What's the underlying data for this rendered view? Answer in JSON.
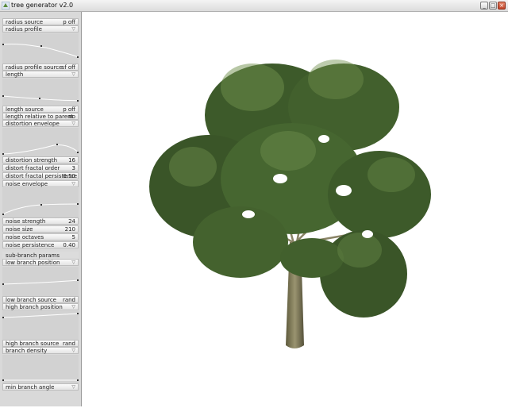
{
  "window": {
    "title": "tree generator v2.0",
    "minimize": "_",
    "maximize": "□",
    "close": "×"
  },
  "panel": {
    "radius_source": {
      "label": "radius source",
      "value": "p off"
    },
    "radius_profile": {
      "label": "radius profile"
    },
    "radius_profile_source": {
      "label": "radius profile source",
      "value": "sf off"
    },
    "length": {
      "label": "length"
    },
    "length_source": {
      "label": "length source",
      "value": "p off"
    },
    "length_relative": {
      "label": "length relative to parent",
      "value": "no"
    },
    "distortion_envelope": {
      "label": "distortion envelope"
    },
    "distortion_strength": {
      "label": "distortion strength",
      "value": "16"
    },
    "distort_fractal_order": {
      "label": "distort fractal order",
      "value": "3"
    },
    "distort_fractal_persistence": {
      "label": "distort fractal persistence",
      "value": "0.50"
    },
    "noise_envelope": {
      "label": "noise envelope"
    },
    "noise_strength": {
      "label": "noise strength",
      "value": "24"
    },
    "noise_size": {
      "label": "noise size",
      "value": "210"
    },
    "noise_octaves": {
      "label": "noise octaves",
      "value": "5"
    },
    "noise_persistence": {
      "label": "noise persistence",
      "value": "0.40"
    },
    "sub_branch_params": {
      "label": "sub-branch params"
    },
    "low_branch_position": {
      "label": "low branch position"
    },
    "low_branch_source": {
      "label": "low branch source",
      "value": "rand"
    },
    "high_branch_position": {
      "label": "high branch position"
    },
    "high_branch_source": {
      "label": "high branch source",
      "value": "rand"
    },
    "branch_density": {
      "label": "branch density"
    },
    "min_branch_angle": {
      "label": "min branch angle"
    }
  },
  "colors": {
    "panel_bg": "#d9d9d9",
    "leaf_dark": "#3d5a2a",
    "leaf_light": "#6f8f4c",
    "trunk": "#7a7350"
  },
  "icons": {
    "app": "tree-app-icon",
    "chevron": "chevron-down-icon"
  }
}
